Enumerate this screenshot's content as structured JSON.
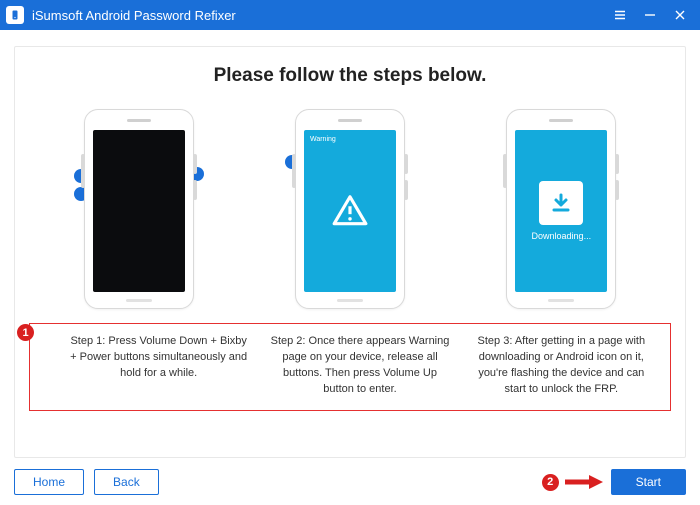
{
  "window": {
    "title": "iSumsoft Android Password Refixer"
  },
  "heading": "Please follow the steps below.",
  "phone2": {
    "warning_label": "Warning"
  },
  "phone3": {
    "downloading_label": "Downloading..."
  },
  "steps": {
    "s1": "Step 1: Press Volume Down + Bixby + Power buttons simultaneously and hold for a while.",
    "s2": "Step 2: Once there appears Warning page on your device, release all buttons. Then press Volume Up button to enter.",
    "s3": "Step 3: After getting in a page with downloading or Android icon on it, you're flashing the device and can start to unlock the FRP."
  },
  "annotations": {
    "one": "1",
    "two": "2"
  },
  "buttons": {
    "home": "Home",
    "back": "Back",
    "start": "Start"
  }
}
